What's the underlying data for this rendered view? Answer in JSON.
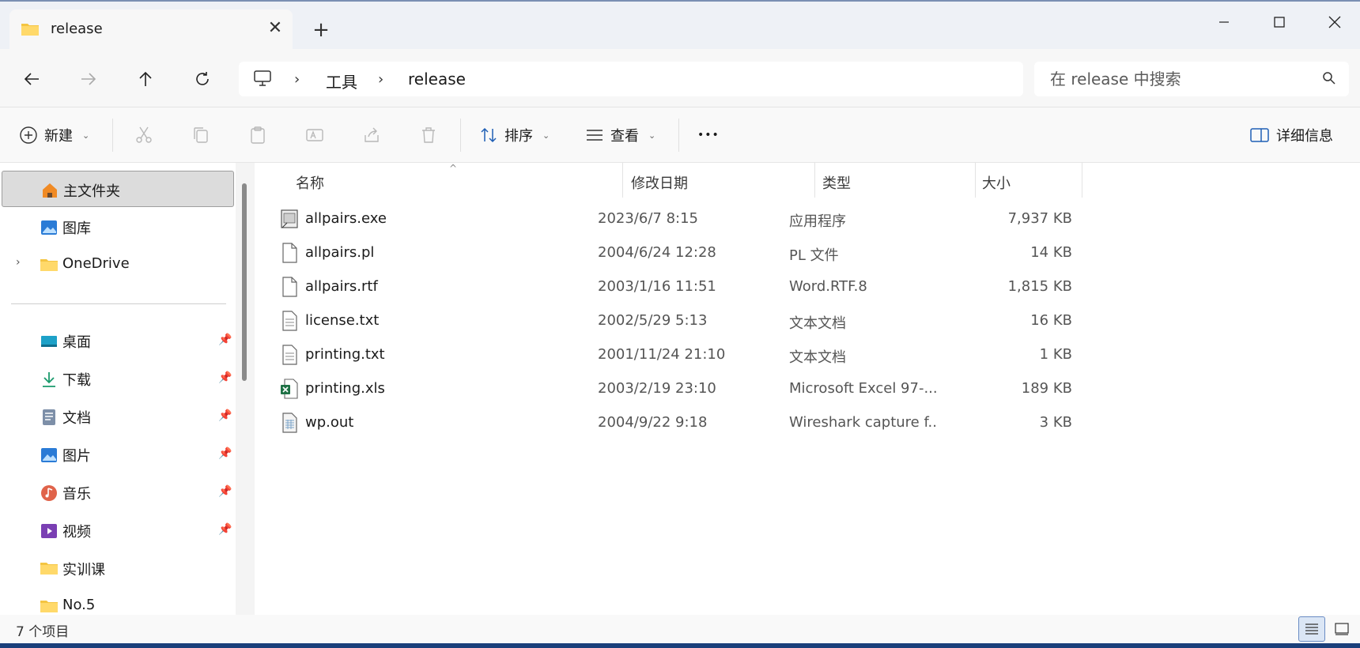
{
  "tab": {
    "title": "release",
    "close": "✕",
    "new_tab": "+"
  },
  "nav": {
    "path": [
      "工具",
      "release"
    ],
    "search_placeholder": "在 release 中搜索"
  },
  "toolbar": {
    "new_label": "新建",
    "sort_label": "排序",
    "view_label": "查看",
    "more_label": "•••",
    "details_label": "详细信息"
  },
  "sidebar": {
    "top_items": [
      {
        "label": "主文件夹",
        "icon": "home-icon"
      },
      {
        "label": "图库",
        "icon": "gallery-icon"
      },
      {
        "label": "OneDrive",
        "icon": "folder-icon"
      }
    ],
    "quick_items": [
      {
        "label": "桌面",
        "icon": "desktop-icon",
        "pinned": true
      },
      {
        "label": "下载",
        "icon": "download-icon",
        "pinned": true
      },
      {
        "label": "文档",
        "icon": "documents-icon",
        "pinned": true
      },
      {
        "label": "图片",
        "icon": "pictures-icon",
        "pinned": true
      },
      {
        "label": "音乐",
        "icon": "music-icon",
        "pinned": true
      },
      {
        "label": "视频",
        "icon": "video-icon",
        "pinned": true
      },
      {
        "label": "实训课",
        "icon": "folder-icon",
        "pinned": false
      },
      {
        "label": "No.5",
        "icon": "folder-icon",
        "pinned": false
      }
    ]
  },
  "columns": {
    "name": "名称",
    "date": "修改日期",
    "type": "类型",
    "size": "大小"
  },
  "files": [
    {
      "name": "allpairs.exe",
      "date": "2023/6/7 8:15",
      "type": "应用程序",
      "size": "7,937 KB",
      "icon": "exe-icon"
    },
    {
      "name": "allpairs.pl",
      "date": "2004/6/24 12:28",
      "type": "PL 文件",
      "size": "14 KB",
      "icon": "file-icon"
    },
    {
      "name": "allpairs.rtf",
      "date": "2003/1/16 11:51",
      "type": "Word.RTF.8",
      "size": "1,815 KB",
      "icon": "file-icon"
    },
    {
      "name": "license.txt",
      "date": "2002/5/29 5:13",
      "type": "文本文档",
      "size": "16 KB",
      "icon": "text-file-icon"
    },
    {
      "name": "printing.txt",
      "date": "2001/11/24 21:10",
      "type": "文本文档",
      "size": "1 KB",
      "icon": "text-file-icon"
    },
    {
      "name": "printing.xls",
      "date": "2003/2/19 23:10",
      "type": "Microsoft Excel 97-...",
      "size": "189 KB",
      "icon": "excel-icon"
    },
    {
      "name": "wp.out",
      "date": "2004/9/22 9:18",
      "type": "Wireshark capture f...",
      "size": "3 KB",
      "icon": "wireshark-icon"
    }
  ],
  "status": {
    "count_text": "7 个项目"
  }
}
